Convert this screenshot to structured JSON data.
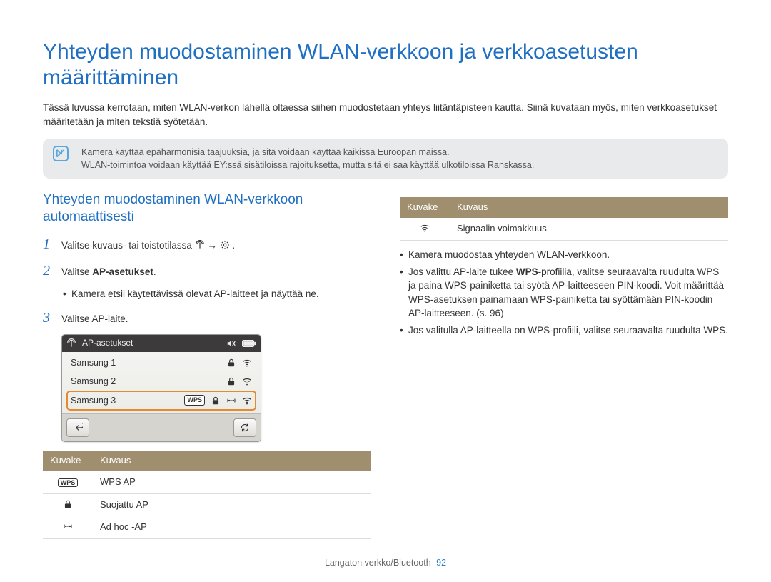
{
  "title": "Yhteyden muodostaminen WLAN-verkkoon ja verkkoasetusten määrittäminen",
  "intro": "Tässä luvussa kerrotaan, miten WLAN-verkon lähellä oltaessa siihen muodostetaan yhteys liitäntäpisteen kautta. Siinä kuvataan myös, miten verkkoasetukset määritetään ja miten tekstiä syötetään.",
  "note": {
    "line1": "Kamera käyttää epäharmonisia taajuuksia, ja sitä voidaan käyttää kaikissa Euroopan maissa.",
    "line2": "WLAN-toimintoa voidaan käyttää EY:ssä sisätiloissa rajoituksetta, mutta sitä ei saa käyttää ulkotiloissa Ranskassa."
  },
  "subheading": "Yhteyden muodostaminen WLAN-verkkoon automaattisesti",
  "steps": {
    "s1_pre": "Valitse kuvaus- tai toistotilassa ",
    "s1_arrow": "→",
    "s2_pre": "Valitse ",
    "s2_bold": "AP-asetukset",
    "s2_post": ".",
    "s2_bullet": "Kamera etsii käytettävissä olevat AP-laitteet ja näyttää ne.",
    "s3": "Valitse AP-laite."
  },
  "device": {
    "header_title": "AP-asetukset",
    "rows": [
      "Samsung 1",
      "Samsung 2",
      "Samsung 3"
    ],
    "wps_label": "WPS"
  },
  "table_headers": {
    "icon": "Kuvake",
    "desc": "Kuvaus"
  },
  "left_table": {
    "r1_icon": "WPS",
    "r1_desc": "WPS AP",
    "r2_desc": "Suojattu AP",
    "r3_desc": "Ad hoc -AP"
  },
  "right_table": {
    "r1_desc": "Signaalin voimakkuus"
  },
  "right_bullets": {
    "b1": "Kamera muodostaa yhteyden WLAN-verkkoon.",
    "b2_pre": "Jos valittu AP-laite tukee ",
    "b2_bold": "WPS",
    "b2_post": "-profiilia, valitse seuraavalta ruudulta WPS ja paina WPS-painiketta tai syötä AP-laitteeseen PIN-koodi. Voit määrittää WPS-asetuksen painamaan WPS-painiketta tai syöttämään PIN-koodin AP-laitteeseen. (s. 96)",
    "b3": "Jos valitulla AP-laitteella on WPS-profiili, valitse seuraavalta ruudulta WPS."
  },
  "footer": {
    "text": "Langaton verkko/Bluetooth",
    "page": "92"
  }
}
